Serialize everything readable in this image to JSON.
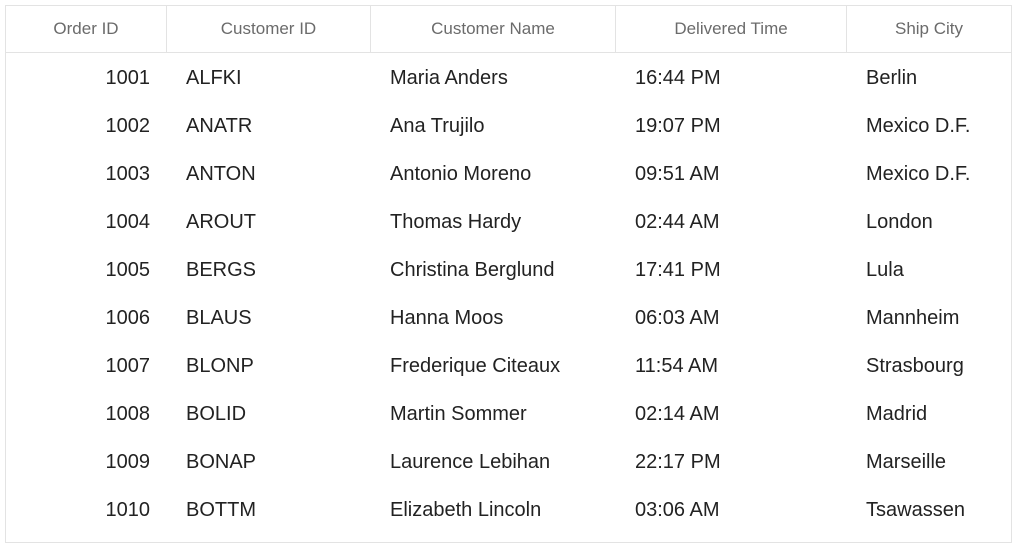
{
  "grid": {
    "columns": [
      {
        "label": "Order ID"
      },
      {
        "label": "Customer ID"
      },
      {
        "label": "Customer Name"
      },
      {
        "label": "Delivered Time"
      },
      {
        "label": "Ship City"
      }
    ],
    "rows": [
      {
        "order_id": "1001",
        "customer_id": "ALFKI",
        "customer_name": "Maria Anders",
        "delivered_time": "16:44 PM",
        "ship_city": "Berlin"
      },
      {
        "order_id": "1002",
        "customer_id": "ANATR",
        "customer_name": "Ana Trujilo",
        "delivered_time": "19:07 PM",
        "ship_city": "Mexico D.F."
      },
      {
        "order_id": "1003",
        "customer_id": "ANTON",
        "customer_name": "Antonio Moreno",
        "delivered_time": "09:51 AM",
        "ship_city": "Mexico D.F."
      },
      {
        "order_id": "1004",
        "customer_id": "AROUT",
        "customer_name": "Thomas Hardy",
        "delivered_time": "02:44 AM",
        "ship_city": "London"
      },
      {
        "order_id": "1005",
        "customer_id": "BERGS",
        "customer_name": "Christina Berglund",
        "delivered_time": "17:41 PM",
        "ship_city": "Lula"
      },
      {
        "order_id": "1006",
        "customer_id": "BLAUS",
        "customer_name": "Hanna Moos",
        "delivered_time": "06:03 AM",
        "ship_city": "Mannheim"
      },
      {
        "order_id": "1007",
        "customer_id": "BLONP",
        "customer_name": "Frederique Citeaux",
        "delivered_time": "11:54 AM",
        "ship_city": "Strasbourg"
      },
      {
        "order_id": "1008",
        "customer_id": "BOLID",
        "customer_name": "Martin Sommer",
        "delivered_time": "02:14 AM",
        "ship_city": "Madrid"
      },
      {
        "order_id": "1009",
        "customer_id": "BONAP",
        "customer_name": "Laurence Lebihan",
        "delivered_time": "22:17 PM",
        "ship_city": "Marseille"
      },
      {
        "order_id": "1010",
        "customer_id": "BOTTM",
        "customer_name": "Elizabeth Lincoln",
        "delivered_time": "03:06 AM",
        "ship_city": "Tsawassen"
      }
    ]
  }
}
